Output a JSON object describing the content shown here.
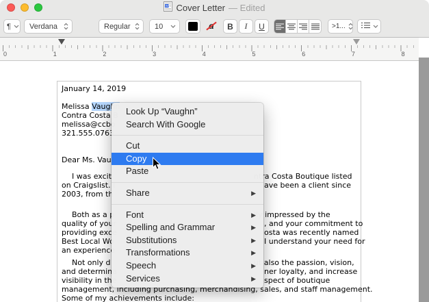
{
  "window": {
    "title": "Cover Letter",
    "edited": "— Edited"
  },
  "toolbar": {
    "paragraph_styles_glyph": "¶",
    "font_family": "Verdana",
    "font_style": "Regular",
    "font_size": "10",
    "text_color": "#000000",
    "char_color_glyph": "a",
    "bold": "B",
    "italic": "I",
    "underline": "U",
    "line_spacing": ">1...",
    "alignment_selected": "left"
  },
  "ruler": {
    "inch_labels": [
      "0",
      "1",
      "2",
      "3",
      "4",
      "5",
      "6",
      "7",
      "8"
    ]
  },
  "document": {
    "blocks": [
      {
        "gap": 4,
        "lines": [
          {
            "left": "January 14, 2019"
          }
        ]
      },
      {
        "gap": 13,
        "lines": [
          {
            "pre": "Melissa ",
            "sel": "Vaughn"
          },
          {
            "left": "Contra Costa B"
          },
          {
            "left": "melissa@ccbo"
          },
          {
            "left": "321.555.0763"
          }
        ]
      },
      {
        "gap": 26,
        "lines": [
          {
            "left": "Dear Ms. Vaug"
          }
        ]
      },
      {
        "gap": 11,
        "lines": [
          {
            "left": "I was excit",
            "right": "ntra Costa Boutique listed",
            "indent": true
          },
          {
            "left": "on Craigslist. I",
            "right": "ave been a client since"
          },
          {
            "left": "2003, from th"
          }
        ]
      },
      {
        "gap": 17,
        "lines": [
          {
            "left": "Both as a p",
            "right": "lly impressed by the",
            "indent": true
          },
          {
            "left": "quality of your",
            "right": ", and your commitment to"
          },
          {
            "left": "providing exce",
            "right": "osta was recently named"
          },
          {
            "left": "Best Local Wo",
            "right": "I understand your need for"
          },
          {
            "left": "an experience"
          }
        ]
      },
      {
        "gap": 5,
        "lines": [
          {
            "left": "Not only d",
            "right": "ut also the passion, vision,",
            "indent": true
          },
          {
            "left": "and determina",
            "right": "ner loyalty, and increase"
          },
          {
            "left": "visibility in the",
            "right": "spect of boutique"
          },
          {
            "left": "management, including purchasing, merchandising, sales, and staff management."
          },
          {
            "left": "Some of my achievements include:"
          }
        ]
      }
    ]
  },
  "context_menu": {
    "items": [
      {
        "label": "Look Up “Vaughn”"
      },
      {
        "label": "Search With Google"
      },
      {
        "type": "separator"
      },
      {
        "label": "Cut"
      },
      {
        "label": "Copy",
        "highlighted": true
      },
      {
        "label": "Paste"
      },
      {
        "type": "separator"
      },
      {
        "label": "Share",
        "submenu": true
      },
      {
        "type": "separator"
      },
      {
        "label": "Font",
        "submenu": true
      },
      {
        "label": "Spelling and Grammar",
        "submenu": true
      },
      {
        "label": "Substitutions",
        "submenu": true
      },
      {
        "label": "Transformations",
        "submenu": true
      },
      {
        "label": "Speech",
        "submenu": true
      },
      {
        "label": "Services",
        "submenu": true
      }
    ]
  },
  "colors": {
    "menu_highlight": "#2E7BF0",
    "text_selection": "#B5D6FC",
    "traffic_red": "#FC5B57",
    "traffic_yellow": "#FDBC2E",
    "traffic_green": "#2BC840"
  }
}
